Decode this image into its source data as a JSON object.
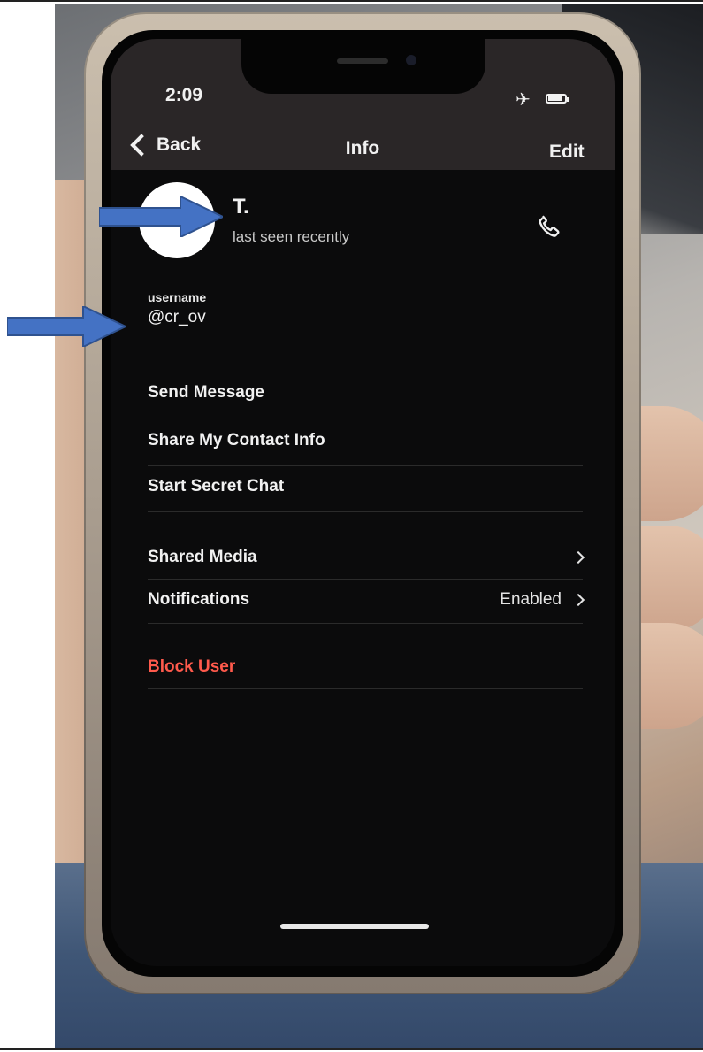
{
  "status_bar": {
    "time": "2:09",
    "icons": [
      "airplane-icon",
      "battery-icon"
    ]
  },
  "nav": {
    "back_label": "Back",
    "title": "Info",
    "edit_label": "Edit"
  },
  "profile": {
    "name": "T.",
    "status": "last seen recently"
  },
  "username": {
    "label": "username",
    "value": "@cr_ov"
  },
  "actions": [
    {
      "label": "Send Message"
    },
    {
      "label": "Share My Contact Info"
    },
    {
      "label": "Start Secret Chat"
    }
  ],
  "settings": [
    {
      "label": "Shared Media",
      "value": ""
    },
    {
      "label": "Notifications",
      "value": "Enabled"
    }
  ],
  "block": {
    "label": "Block User"
  },
  "colors": {
    "block_red": "#ff5a4c",
    "arrow_blue": "#4472c4",
    "screen_bg": "#0b0b0c"
  }
}
